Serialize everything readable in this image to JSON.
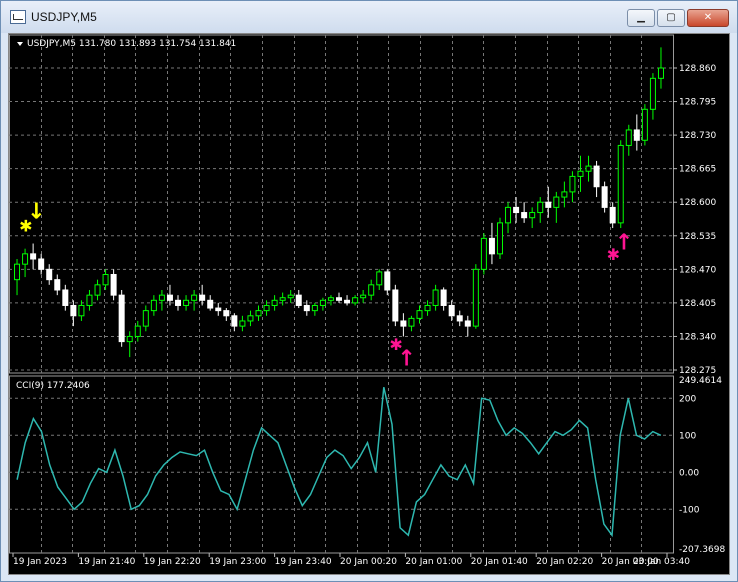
{
  "window": {
    "title": "USDJPY,M5",
    "buttons": {
      "minimize": "▁",
      "maximize": "▢",
      "close": "✕"
    }
  },
  "chart_data": [
    {
      "type": "candlestick",
      "header": "USDJPY,M5  131.780 131.893 131.754 131.841",
      "y_ticks": [
        "128.860",
        "128.795",
        "128.730",
        "128.665",
        "128.600",
        "128.535",
        "128.470",
        "128.405",
        "128.340",
        "128.275"
      ],
      "ylim": [
        128.275,
        128.86
      ],
      "grid": true,
      "colors": {
        "up": "#00ff00",
        "down": "#ffffff",
        "body_up": "#000000",
        "body_down": "#ffffff",
        "grid": "#808080"
      },
      "candles": [
        [
          128.45,
          128.49,
          128.42,
          128.48
        ],
        [
          128.48,
          128.51,
          128.455,
          128.5
        ],
        [
          128.5,
          128.52,
          128.47,
          128.49
        ],
        [
          128.49,
          128.5,
          128.46,
          128.47
        ],
        [
          128.47,
          128.48,
          128.44,
          128.45
        ],
        [
          128.45,
          128.46,
          128.42,
          128.43
        ],
        [
          128.43,
          128.44,
          128.39,
          128.4
        ],
        [
          128.4,
          128.41,
          128.36,
          128.38
        ],
        [
          128.38,
          128.41,
          128.37,
          128.4
        ],
        [
          128.4,
          128.43,
          128.39,
          128.42
        ],
        [
          128.42,
          128.45,
          128.41,
          128.44
        ],
        [
          128.44,
          128.47,
          128.43,
          128.46
        ],
        [
          128.46,
          128.47,
          128.41,
          128.42
        ],
        [
          128.42,
          128.43,
          128.32,
          128.33
        ],
        [
          128.33,
          128.35,
          128.3,
          128.34
        ],
        [
          128.34,
          128.37,
          128.33,
          128.36
        ],
        [
          128.36,
          128.4,
          128.35,
          128.39
        ],
        [
          128.39,
          128.42,
          128.38,
          128.41
        ],
        [
          128.41,
          128.43,
          128.39,
          128.42
        ],
        [
          128.42,
          128.44,
          128.4,
          128.41
        ],
        [
          128.41,
          128.42,
          128.39,
          128.4
        ],
        [
          128.4,
          128.42,
          128.39,
          128.41
        ],
        [
          128.41,
          128.43,
          128.39,
          128.42
        ],
        [
          128.42,
          128.44,
          128.4,
          128.41
        ],
        [
          128.41,
          128.42,
          128.39,
          128.395
        ],
        [
          128.395,
          128.405,
          128.38,
          128.39
        ],
        [
          128.39,
          128.395,
          128.37,
          128.38
        ],
        [
          128.38,
          128.385,
          128.35,
          128.36
        ],
        [
          128.36,
          128.38,
          128.35,
          128.37
        ],
        [
          128.37,
          128.39,
          128.36,
          128.38
        ],
        [
          128.38,
          128.4,
          128.37,
          128.39
        ],
        [
          128.39,
          128.41,
          128.38,
          128.4
        ],
        [
          128.4,
          128.42,
          128.39,
          128.41
        ],
        [
          128.41,
          128.425,
          128.4,
          128.415
        ],
        [
          128.415,
          128.43,
          128.405,
          128.42
        ],
        [
          128.42,
          128.43,
          128.395,
          128.4
        ],
        [
          128.4,
          128.41,
          128.38,
          128.39
        ],
        [
          128.39,
          128.405,
          128.38,
          128.4
        ],
        [
          128.4,
          128.415,
          128.39,
          128.41
        ],
        [
          128.41,
          128.42,
          128.4,
          128.415
        ],
        [
          128.415,
          128.425,
          128.405,
          128.41
        ],
        [
          128.41,
          128.42,
          128.4,
          128.405
        ],
        [
          128.405,
          128.42,
          128.4,
          128.415
        ],
        [
          128.415,
          128.43,
          128.405,
          128.42
        ],
        [
          128.42,
          128.45,
          128.41,
          128.44
        ],
        [
          128.44,
          128.47,
          128.43,
          128.465
        ],
        [
          128.465,
          128.47,
          128.42,
          128.43
        ],
        [
          128.43,
          128.44,
          128.36,
          128.37
        ],
        [
          128.37,
          128.385,
          128.34,
          128.36
        ],
        [
          128.36,
          128.38,
          128.35,
          128.375
        ],
        [
          128.375,
          128.4,
          128.365,
          128.39
        ],
        [
          128.39,
          128.41,
          128.38,
          128.4
        ],
        [
          128.4,
          128.44,
          128.39,
          128.43
        ],
        [
          128.43,
          128.435,
          128.39,
          128.4
        ],
        [
          128.4,
          128.41,
          128.37,
          128.38
        ],
        [
          128.38,
          128.39,
          128.36,
          128.37
        ],
        [
          128.37,
          128.38,
          128.34,
          128.36
        ],
        [
          128.36,
          128.48,
          128.355,
          128.47
        ],
        [
          128.47,
          128.54,
          128.46,
          128.53
        ],
        [
          128.53,
          128.56,
          128.48,
          128.5
        ],
        [
          128.5,
          128.57,
          128.49,
          128.56
        ],
        [
          128.56,
          128.6,
          128.54,
          128.59
        ],
        [
          128.59,
          128.61,
          128.56,
          128.58
        ],
        [
          128.58,
          128.6,
          128.56,
          128.57
        ],
        [
          128.57,
          128.59,
          128.55,
          128.58
        ],
        [
          128.58,
          128.61,
          128.56,
          128.6
        ],
        [
          128.6,
          128.63,
          128.57,
          128.59
        ],
        [
          128.59,
          128.62,
          128.56,
          128.61
        ],
        [
          128.61,
          128.64,
          128.59,
          128.62
        ],
        [
          128.62,
          128.66,
          128.6,
          128.65
        ],
        [
          128.65,
          128.69,
          128.62,
          128.66
        ],
        [
          128.66,
          128.69,
          128.64,
          128.67
        ],
        [
          128.67,
          128.68,
          128.61,
          128.63
        ],
        [
          128.63,
          128.64,
          128.58,
          128.59
        ],
        [
          128.59,
          128.6,
          128.55,
          128.56
        ],
        [
          128.56,
          128.72,
          128.55,
          128.71
        ],
        [
          128.71,
          128.75,
          128.69,
          128.74
        ],
        [
          128.74,
          128.77,
          128.7,
          128.72
        ],
        [
          128.72,
          128.79,
          128.71,
          128.78
        ],
        [
          128.78,
          128.85,
          128.76,
          128.84
        ],
        [
          128.84,
          128.9,
          128.82,
          128.86
        ]
      ],
      "annotations": [
        {
          "symbol": "✱",
          "color": "#ffff00",
          "at_candle": 1,
          "price": 128.555
        },
        {
          "symbol": "↓",
          "color": "#ffff00",
          "at_candle": 2,
          "price": 128.58
        },
        {
          "symbol": "✱",
          "color": "#ff1493",
          "at_candle": 47,
          "price": 128.325
        },
        {
          "symbol": "↑",
          "color": "#ff1493",
          "at_candle": 48,
          "price": 128.295
        },
        {
          "symbol": "✱",
          "color": "#ff1493",
          "at_candle": 74,
          "price": 128.5
        },
        {
          "symbol": "↑",
          "color": "#ff1493",
          "at_candle": 75,
          "price": 128.52
        }
      ]
    },
    {
      "type": "line",
      "header": "CCI(9) 177.2406",
      "series": [
        {
          "name": "CCI(9)",
          "color": "#2eb8b0",
          "values": [
            -20,
            80,
            145,
            110,
            20,
            -40,
            -70,
            -100,
            -80,
            -30,
            10,
            0,
            60,
            -10,
            -100,
            -90,
            -60,
            -10,
            20,
            40,
            55,
            50,
            45,
            60,
            0,
            -50,
            -60,
            -100,
            -20,
            60,
            120,
            100,
            80,
            20,
            -40,
            -90,
            -60,
            -10,
            40,
            60,
            45,
            10,
            40,
            80,
            0,
            230,
            130,
            -150,
            -170,
            -80,
            -60,
            -20,
            20,
            -10,
            -20,
            20,
            -30,
            200,
            195,
            140,
            100,
            120,
            105,
            80,
            50,
            80,
            110,
            100,
            115,
            140,
            120,
            -20,
            -140,
            -170,
            100,
            200,
            100,
            90,
            110,
            100
          ]
        }
      ],
      "y_ticks": [
        "249.4614",
        "200",
        "100",
        "0.00",
        "-100",
        "-207.3698"
      ],
      "ylim": [
        -207.3698,
        249.4614
      ],
      "grid": true
    }
  ],
  "x_axis": {
    "labels": [
      "19 Jan 2023",
      "19 Jan 21:40",
      "19 Jan 22:20",
      "19 Jan 23:00",
      "19 Jan 23:40",
      "20 Jan 00:20",
      "20 Jan 01:00",
      "20 Jan 01:40",
      "20 Jan 02:20",
      "20 Jan 03:00",
      "20 Jan 03:40"
    ]
  }
}
